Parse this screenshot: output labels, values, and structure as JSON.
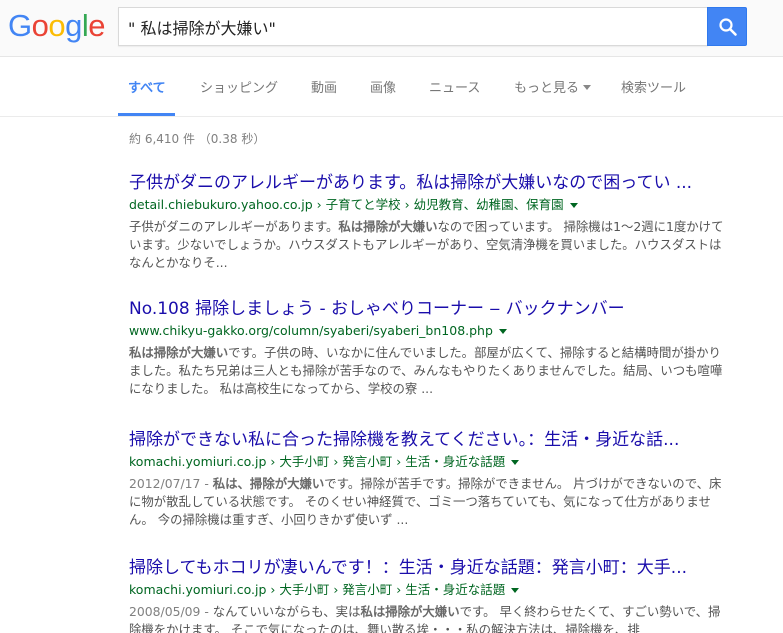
{
  "logo": {
    "letters": [
      {
        "ch": "G",
        "color": "#4285f4"
      },
      {
        "ch": "o",
        "color": "#ea4335"
      },
      {
        "ch": "o",
        "color": "#fbbc05"
      },
      {
        "ch": "g",
        "color": "#4285f4"
      },
      {
        "ch": "l",
        "color": "#34a853"
      },
      {
        "ch": "e",
        "color": "#ea4335"
      }
    ]
  },
  "search": {
    "value": "\" 私は掃除が大嫌い\"",
    "button_icon": "search-icon",
    "button_color": "#4285f4"
  },
  "tabs": [
    {
      "label": "すべて",
      "active": true
    },
    {
      "label": "ショッピング"
    },
    {
      "label": "動画"
    },
    {
      "label": "画像"
    },
    {
      "label": "ニュース"
    },
    {
      "label": "もっと見る",
      "has_caret": true
    },
    {
      "label": "検索ツール"
    }
  ],
  "stats": "約 6,410 件 （0.38 秒）",
  "results": [
    {
      "title": "子供がダニのアレルギーがあります。私は掃除が大嫌いなので困ってい ...",
      "url": "detail.chiebukuro.yahoo.co.jp › 子育てと学校 › 幼児教育、幼稚園、保育園",
      "snippet": [
        {
          "t": "子供がダニのアレルギーがあります。"
        },
        {
          "t": "私は掃除が大嫌い",
          "b": true
        },
        {
          "t": "なので困っています。 掃除機は1〜2週に1度かけています。少ないでしょうか。ハウスダストもアレルギーがあり、空気清浄機を買いました。ハウスダストはなんとかなりそ..."
        }
      ]
    },
    {
      "title": "No.108 掃除しましょう - おしゃべりコーナー ‒ バックナンバー",
      "url": "www.chikyu-gakko.org/column/syaberi/syaberi_bn108.php",
      "snippet": [
        {
          "t": "私は掃除が大嫌い",
          "b": true
        },
        {
          "t": "です。子供の時、いなかに住んでいました。部屋が広くて、掃除すると結構時間が掛かりました。私たち兄弟は三人とも掃除が苦手なので、みんなもやりたくありませんでした。結局、いつも喧嘩になりました。 私は高校生になってから、学校の寮 ..."
        }
      ]
    },
    {
      "title": "掃除ができない私に合った掃除機を教えてください。：生活・身近な話...",
      "url": "komachi.yomiuri.co.jp › 大手小町 › 発言小町 › 生活・身近な話題",
      "snippet": [
        {
          "t": "2012/07/17 - ",
          "d": true
        },
        {
          "t": "私は、掃除が大嫌い",
          "b": true
        },
        {
          "t": "です。掃除が苦手です。掃除ができません。 片づけができないので、床に物が散乱している状態です。 そのくせい神経質で、ゴミ一つ落ちていても、気になって仕方がありません。 今の掃除機は重すぎ、小回りきかず使いず ..."
        }
      ]
    },
    {
      "title": "掃除してもホコリが凄いんです！：生活・身近な話題：発言小町：大手...",
      "url": "komachi.yomiuri.co.jp › 大手小町 › 発言小町 › 生活・身近な話題",
      "snippet": [
        {
          "t": "2008/05/09 - ",
          "d": true
        },
        {
          "t": "なんていいながらも、実は"
        },
        {
          "t": "私は掃除が大嫌い",
          "b": true
        },
        {
          "t": "です。 早く終わらせたくて、すごい勢いで、掃除機をかけます。 そこで気になったのは、舞い散る埃・・・私の解決方法は、掃除機を、排"
        }
      ]
    }
  ]
}
